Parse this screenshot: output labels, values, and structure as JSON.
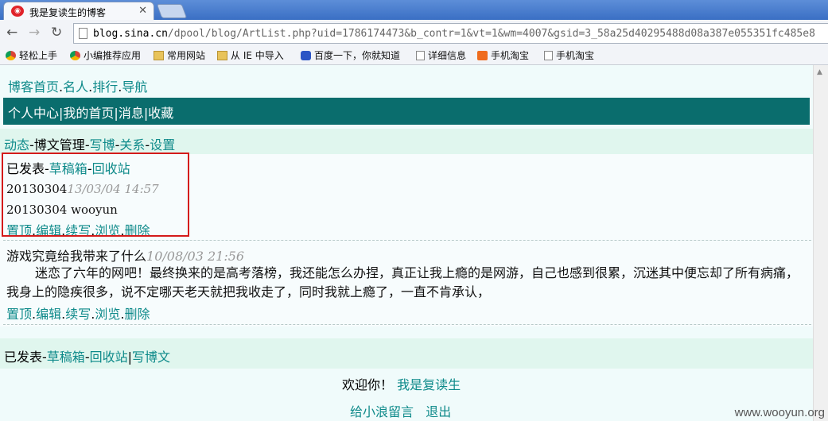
{
  "browser": {
    "tab_title": "我是复读生的博客",
    "url_host": "blog.sina.cn",
    "url_rest": "/dpool/blog/ArtList.php?uid=1786174473&b_contr=1&vt=1&wm=4007&gsid=3_58a25d40295488d08a387e055351fc485e8",
    "bookmarks": [
      "轻松上手",
      "小编推荐应用",
      "常用网站",
      "从 IE 中导入",
      "百度一下，你就知道",
      "详细信息",
      "手机淘宝",
      "手机淘宝"
    ]
  },
  "page": {
    "top_nav": [
      "博客首页",
      "名人",
      "排行",
      "导航"
    ],
    "user_nav": [
      "个人中心",
      "我的首页",
      "消息",
      "收藏"
    ],
    "section_nav": {
      "links": [
        "动态",
        "写博",
        "关系",
        "设置"
      ],
      "current": "博文管理"
    },
    "post_tabs": {
      "current": "已发表",
      "links": [
        "草稿箱",
        "回收站"
      ],
      "write": "写博文"
    },
    "post1": {
      "title": "20130304",
      "time": "13/03/04 14:57",
      "summary": "20130304 wooyun"
    },
    "post2": {
      "title": "游戏究竟给我带来了什么",
      "time": "10/08/03 21:56",
      "summary": "迷恋了六年的网吧！最终换来的是高考落榜，我还能怎么办捏，真正让我上瘾的是网游，自己也感到很累，沉迷其中便忘却了所有病痛，我身上的隐疾很多，说不定哪天老天就把我收走了，同时我就上瘾了，一直不肯承认，"
    },
    "actions": [
      "置顶",
      "编辑",
      "续写",
      "浏览",
      "删除"
    ],
    "welcome": "欢迎你！",
    "username": "我是复读生",
    "footer_links": [
      "给小浪留言",
      "退出"
    ],
    "watermark": "www.wooyun.org"
  }
}
